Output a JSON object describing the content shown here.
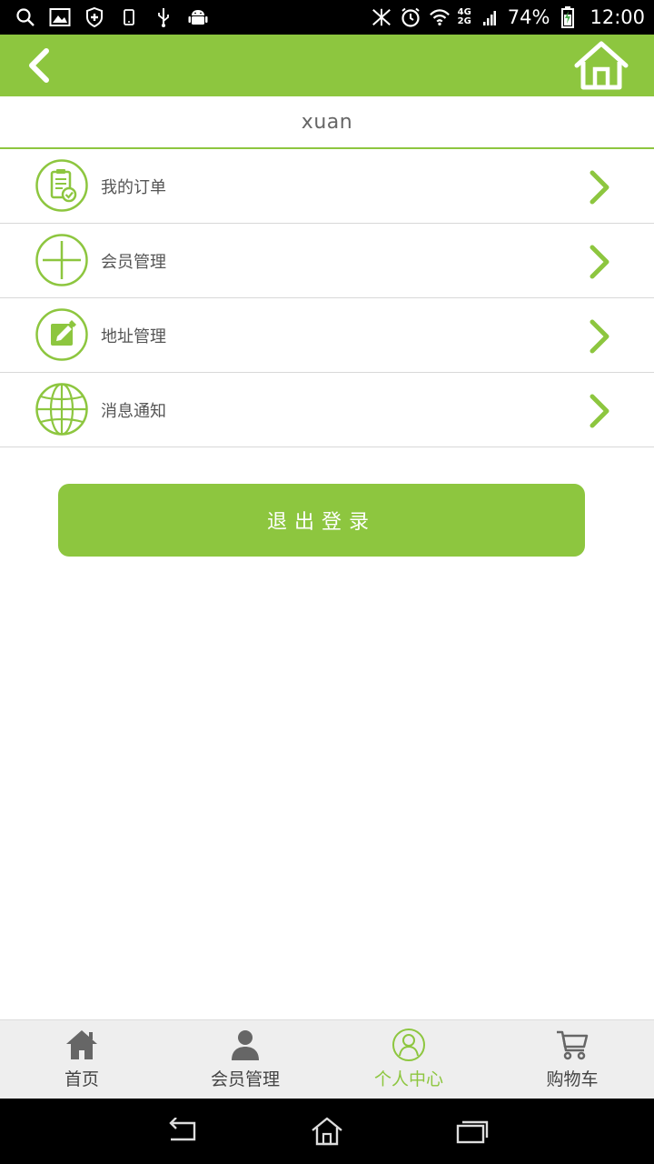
{
  "status_bar": {
    "battery_percent": "74%",
    "time": "12:00",
    "network_top": "4G",
    "network_bottom": "2G"
  },
  "header": {
    "back_icon": "chevron-left-icon",
    "home_icon": "home-icon"
  },
  "user": {
    "name": "xuan"
  },
  "menu": {
    "items": [
      {
        "label": "我的订单",
        "icon": "clipboard-check-icon"
      },
      {
        "label": "会员管理",
        "icon": "plus-circle-icon"
      },
      {
        "label": "地址管理",
        "icon": "edit-note-icon"
      },
      {
        "label": "消息通知",
        "icon": "globe-icon"
      }
    ]
  },
  "logout": {
    "label": "退出登录"
  },
  "tabbar": {
    "items": [
      {
        "label": "首页",
        "icon": "home-icon"
      },
      {
        "label": "会员管理",
        "icon": "user-icon"
      },
      {
        "label": "个人中心",
        "icon": "profile-circle-icon"
      },
      {
        "label": "购物车",
        "icon": "cart-icon"
      }
    ],
    "active_index": 2
  },
  "colors": {
    "accent": "#8dc63f",
    "text": "#555555",
    "tab_bg": "#eeeeee"
  }
}
